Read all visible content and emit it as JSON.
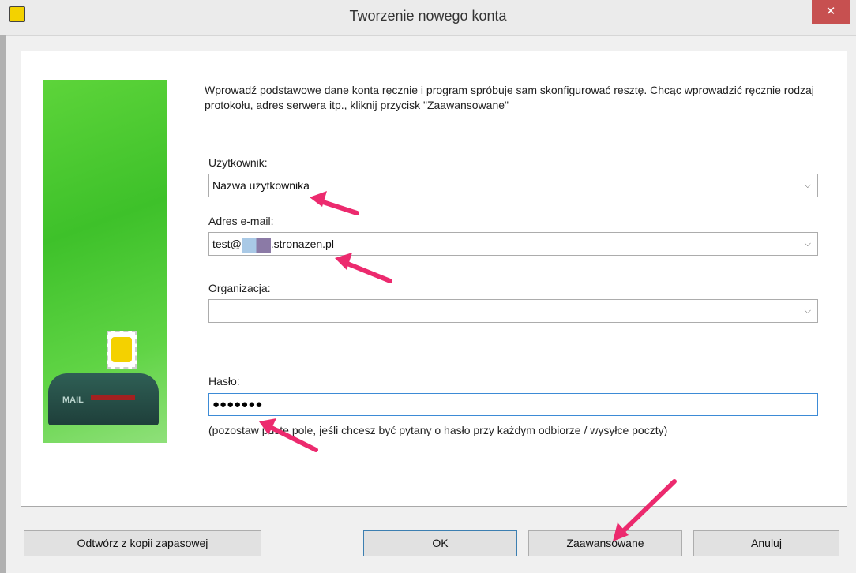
{
  "window": {
    "title": "Tworzenie nowego konta",
    "close_glyph": "✕"
  },
  "intro_text": "Wprowadź podstawowe dane konta ręcznie i program spróbuje sam skonfigurować resztę. Chcąc wprowadzić ręcznie rodzaj protokołu, adres serwera itp., kliknij przycisk \"Zaawansowane\"",
  "fields": {
    "user": {
      "label": "Użytkownik:",
      "value": "Nazwa użytkownika"
    },
    "email": {
      "label": "Adres e-mail:",
      "value_prefix": "test@",
      "value_suffix": ".stronazen.pl"
    },
    "org": {
      "label": "Organizacja:",
      "value": ""
    },
    "password": {
      "label": "Hasło:",
      "value": "●●●●●●●"
    }
  },
  "password_hint": "(pozostaw puste pole, jeśli chcesz być pytany o hasło przy każdym odbiorze / wysyłce poczty)",
  "mailbox_label": "MAIL",
  "buttons": {
    "restore": "Odtwórz z kopii zapasowej",
    "ok": "OK",
    "advanced": "Zaawansowane",
    "cancel": "Anuluj"
  },
  "icons": {
    "app": "bat-logo-icon",
    "close": "close-icon",
    "dropdown": "chevron-down-icon",
    "annotation": "annotation-arrow-icon"
  },
  "colors": {
    "annotation": "#ec2a6e",
    "close": "#c75050",
    "illustration": "#4cc833"
  }
}
